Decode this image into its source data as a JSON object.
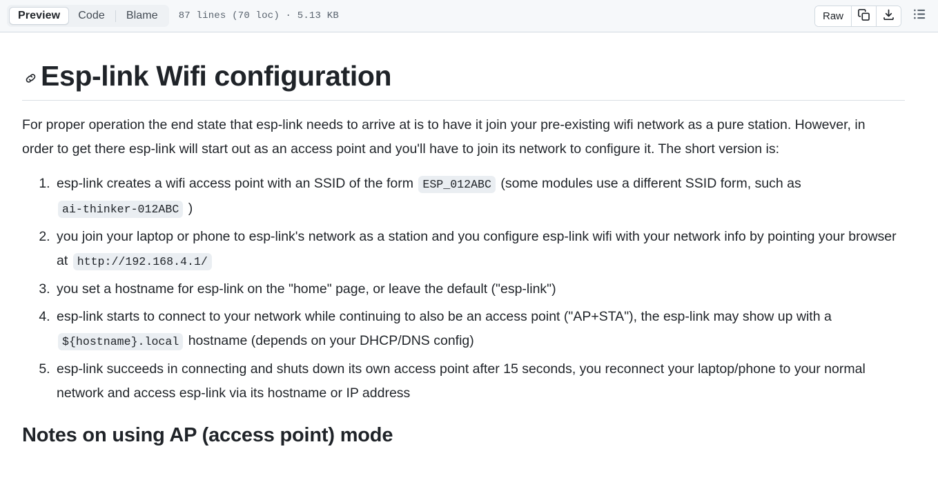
{
  "header": {
    "tabs": [
      {
        "label": "Preview",
        "active": true
      },
      {
        "label": "Code",
        "active": false
      },
      {
        "label": "Blame",
        "active": false
      }
    ],
    "file_meta": "87 lines (70 loc) · 5.13 KB",
    "raw_label": "Raw",
    "copy_icon": "copy-icon",
    "download_icon": "download-icon",
    "outline_icon": "unordered-list-icon"
  },
  "document": {
    "anchor_icon": "link-icon",
    "title": "Esp-link Wifi configuration",
    "intro": "For proper operation the end state that esp-link needs to arrive at is to have it join your pre-existing wifi network as a pure station. However, in order to get there esp-link will start out as an access point and you'll have to join its network to configure it. The short version is:",
    "steps": [
      {
        "parts": [
          {
            "type": "text",
            "value": "esp-link creates a wifi access point with an SSID of the form "
          },
          {
            "type": "code",
            "value": "ESP_012ABC"
          },
          {
            "type": "text",
            "value": " (some modules use a different SSID form, such as "
          },
          {
            "type": "code",
            "value": "ai-thinker-012ABC"
          },
          {
            "type": "text",
            "value": " )"
          }
        ]
      },
      {
        "parts": [
          {
            "type": "text",
            "value": "you join your laptop or phone to esp-link's network as a station and you configure esp-link wifi with your network info by pointing your browser at "
          },
          {
            "type": "code",
            "value": "http://192.168.4.1/"
          }
        ]
      },
      {
        "parts": [
          {
            "type": "text",
            "value": "you set a hostname for esp-link on the \"home\" page, or leave the default (\"esp-link\")"
          }
        ]
      },
      {
        "parts": [
          {
            "type": "text",
            "value": "esp-link starts to connect to your network while continuing to also be an access point (\"AP+STA\"), the esp-link may show up with a "
          },
          {
            "type": "code",
            "value": "${hostname}.local"
          },
          {
            "type": "text",
            "value": " hostname (depends on your DHCP/DNS config)"
          }
        ]
      },
      {
        "parts": [
          {
            "type": "text",
            "value": "esp-link succeeds in connecting and shuts down its own access point after 15 seconds, you reconnect your laptop/phone to your normal network and access esp-link via its hostname or IP address"
          }
        ]
      }
    ],
    "section_heading": "Notes on using AP (access point) mode"
  },
  "colors": {
    "header_bg": "#f6f8fa",
    "header_border": "#d1d9e0",
    "tab_group_bg": "#eef1f4",
    "text": "#1f2328",
    "muted_text": "#59636e",
    "code_bg": "#eaeef2",
    "rule": "#d8dee4"
  }
}
